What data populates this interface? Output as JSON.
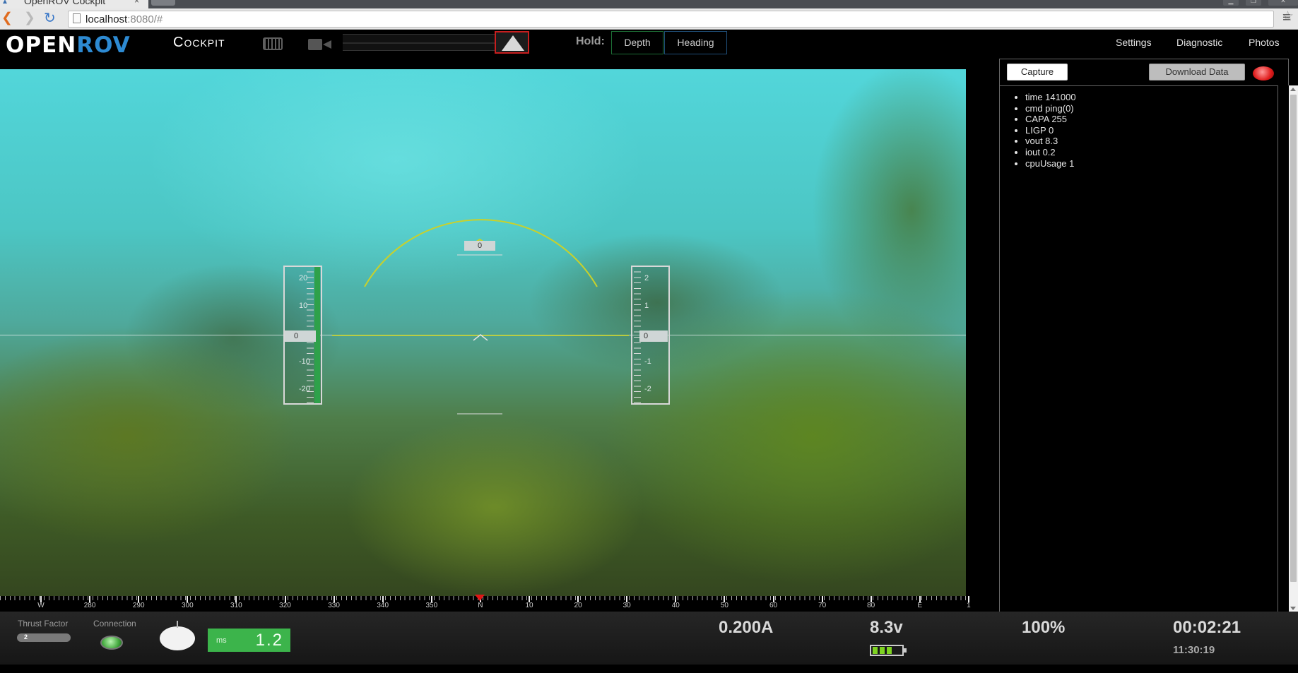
{
  "browser": {
    "tab_title": "OpenROV Cockpit",
    "url_host": "localhost",
    "url_rest": ":8080/#"
  },
  "header": {
    "logo_left": "OPEN",
    "logo_right": "ROV",
    "subtitle": "Cockpit",
    "hold_label": "Hold:",
    "hold_depth": "Depth",
    "hold_heading": "Heading",
    "nav": [
      "Settings",
      "Diagnostic",
      "Photos"
    ]
  },
  "hud": {
    "pitch_readout": "0",
    "speed_tape": {
      "labels": [
        "20",
        "10",
        "-10",
        "-20"
      ],
      "readout": "0"
    },
    "depth_tape": {
      "labels": [
        "2",
        "1",
        "-1",
        "-2"
      ],
      "readout": "0"
    },
    "compass": {
      "labels": [
        "W",
        "280",
        "290",
        "300",
        "310",
        "320",
        "330",
        "340",
        "350",
        "N",
        "10",
        "20",
        "30",
        "40",
        "50",
        "60",
        "70",
        "80",
        "E",
        "1"
      ]
    }
  },
  "panel": {
    "capture_label": "Capture",
    "download_label": "Download Data",
    "telemetry": [
      "time 141000",
      "cmd ping(0)",
      "CAPA 255",
      "LIGP 0",
      "vout 8.3",
      "iout 0.2",
      "cpuUsage 1"
    ]
  },
  "status": {
    "thrust_label": "Thrust Factor",
    "thrust_value": "2",
    "connection_label": "Connection",
    "latency_unit": "ms",
    "latency_value": "1.2",
    "current": "0.200A",
    "voltage": "8.3v",
    "throttle": "100%",
    "elapsed": "00:02:21",
    "clock": "11:30:19",
    "battery_level": 0.75
  },
  "colors": {
    "accent_blue": "#2d8ad2",
    "led_green": "#3fa63a",
    "latency_green": "#3cb44b",
    "record_red": "#e01c1c"
  }
}
